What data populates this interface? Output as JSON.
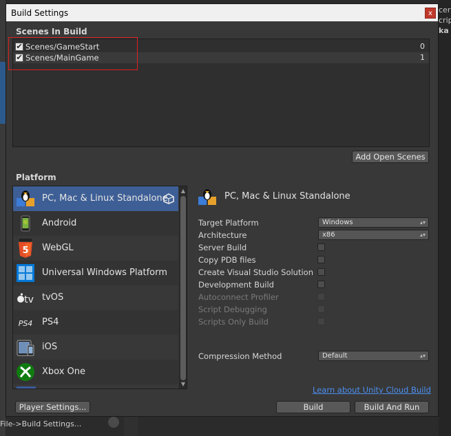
{
  "background": {
    "right_lines": [
      "cer",
      "crip",
      "ka"
    ],
    "bottom_text": "File->Build Settings..."
  },
  "window": {
    "title": "Build Settings",
    "close_label": "x"
  },
  "scenes": {
    "heading": "Scenes In Build",
    "items": [
      {
        "path": "Scenes/GameStart",
        "index": "0",
        "checked": true
      },
      {
        "path": "Scenes/MainGame",
        "index": "1",
        "checked": true
      }
    ],
    "add_open_scenes_label": "Add Open Scenes"
  },
  "platform": {
    "heading": "Platform",
    "items": [
      {
        "label": "PC, Mac & Linux Standalone",
        "icon": "pc-mac-linux-icon",
        "selected": true
      },
      {
        "label": "Android",
        "icon": "android-icon"
      },
      {
        "label": "WebGL",
        "icon": "html5-icon"
      },
      {
        "label": "Universal Windows Platform",
        "icon": "windows-icon"
      },
      {
        "label": "tvOS",
        "icon": "apple-tv-icon"
      },
      {
        "label": "PS4",
        "icon": "ps4-icon"
      },
      {
        "label": "iOS",
        "icon": "ios-device-icon"
      },
      {
        "label": "Xbox One",
        "icon": "xbox-icon"
      }
    ]
  },
  "settings": {
    "selected_platform_title": "PC, Mac & Linux Standalone",
    "target_platform": {
      "label": "Target Platform",
      "value": "Windows"
    },
    "architecture": {
      "label": "Architecture",
      "value": "x86"
    },
    "server_build": {
      "label": "Server Build"
    },
    "copy_pdb": {
      "label": "Copy PDB files"
    },
    "create_vs": {
      "label": "Create Visual Studio Solution"
    },
    "development_build": {
      "label": "Development Build"
    },
    "autoconnect_profiler": {
      "label": "Autoconnect Profiler"
    },
    "script_debugging": {
      "label": "Script Debugging"
    },
    "scripts_only_build": {
      "label": "Scripts Only Build"
    },
    "compression_method": {
      "label": "Compression Method",
      "value": "Default"
    }
  },
  "footer": {
    "cloud_link": "Learn about Unity Cloud Build",
    "player_settings_label": "Player Settings...",
    "build_label": "Build",
    "build_and_run_label": "Build And Run"
  },
  "colors": {
    "selection": "#3e5f96",
    "link": "#4c8ff0",
    "highlight_border": "#e02020"
  }
}
